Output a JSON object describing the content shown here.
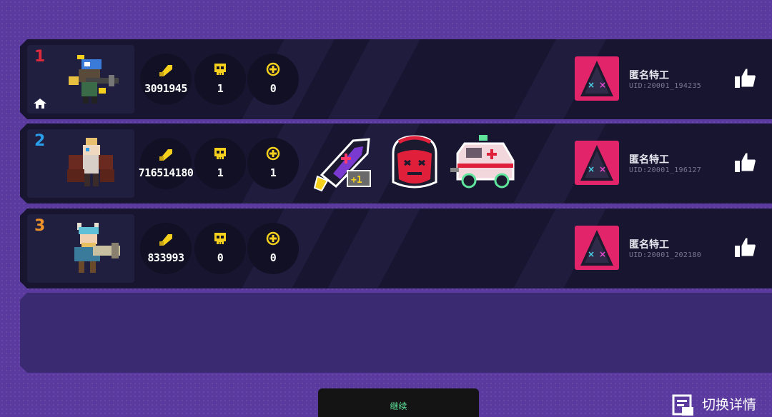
{
  "players": [
    {
      "rank": "1",
      "rank_color": "#e02a3c",
      "is_host": true,
      "coins": "3091945",
      "kills": "1",
      "revives": "0",
      "name": "匿名特工",
      "uid": "UID:20001_194235",
      "character_icon": "knight-with-gun-icon",
      "buffs": []
    },
    {
      "rank": "2",
      "rank_color": "#2a9de8",
      "is_host": false,
      "coins": "716514180",
      "kills": "1",
      "revives": "1",
      "name": "匿名特工",
      "uid": "UID:20001_196127",
      "character_icon": "caped-gunner-icon",
      "buffs": [
        "rocket-plus-one-icon",
        "red-demon-head-icon",
        "ambulance-icon"
      ]
    },
    {
      "rank": "3",
      "rank_color": "#f0922a",
      "is_host": false,
      "coins": "833993",
      "kills": "0",
      "revives": "0",
      "name": "匿名特工",
      "uid": "UID:20001_202180",
      "character_icon": "viking-with-cannon-icon",
      "buffs": []
    }
  ],
  "stat_icons": {
    "coins": "bullet-icon",
    "kills": "skull-icon",
    "revives": "plus-circle-icon"
  },
  "colors": {
    "stat_icon": "#f5d11e",
    "avatar_bg": "#e2246a",
    "accent_green": "#5fe49c"
  },
  "footer": {
    "continue_label": "继续",
    "switch_label": "切换详情",
    "switch_icon": "details-document-icon"
  }
}
